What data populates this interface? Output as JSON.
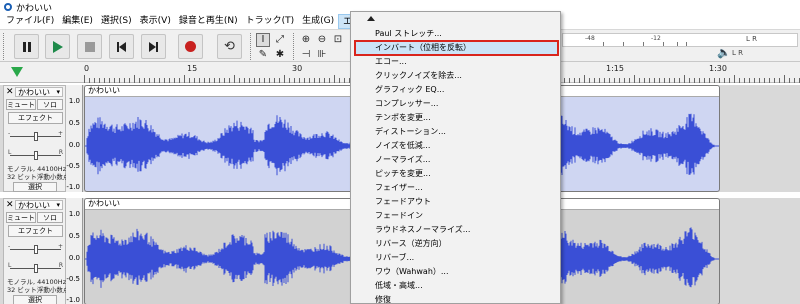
{
  "window": {
    "title": "かわいい"
  },
  "menu": [
    {
      "label": "ファイル(F)"
    },
    {
      "label": "編集(E)"
    },
    {
      "label": "選択(S)"
    },
    {
      "label": "表示(V)"
    },
    {
      "label": "録音と再生(N)"
    },
    {
      "label": "トラック(T)"
    },
    {
      "label": "生成(G)"
    },
    {
      "label": "エフェクト(C)",
      "active": true
    }
  ],
  "toolbar": {
    "meter_ticks": [
      "-48",
      "-12",
      "-48",
      "-12"
    ],
    "meter_labels": {
      "record": "L R",
      "play": "L R"
    }
  },
  "ruler": {
    "labels": [
      "0",
      "15",
      "30",
      "1:15",
      "1:30"
    ]
  },
  "tracks": [
    {
      "name": "かわいい",
      "mute_label": "ミュート",
      "solo_label": "ソロ",
      "effects_label": "エフェクト",
      "gain_minus": "-",
      "gain_plus": "+",
      "pan_l": "L",
      "pan_r": "R",
      "info_line1": "モノラル, 44100Hz",
      "info_line2": "32 ビット浮動小数点",
      "select_label": "選択",
      "scale": [
        "1.0",
        "0.5",
        "0.0",
        "-0.5",
        "-1.0"
      ],
      "clip_name": "かわいい"
    },
    {
      "name": "かわいい",
      "mute_label": "ミュート",
      "solo_label": "ソロ",
      "effects_label": "エフェクト",
      "gain_minus": "-",
      "gain_plus": "+",
      "pan_l": "L",
      "pan_r": "R",
      "info_line1": "モノラル, 44100Hz",
      "info_line2": "32 ビット浮動小数点",
      "select_label": "選択",
      "scale": [
        "1.0",
        "0.5",
        "0.0",
        "-0.5",
        "-1.0"
      ],
      "clip_name": "かわいい"
    }
  ],
  "effects_menu": {
    "items": [
      "Paul ストレッチ...",
      "インバート（位相を反転）",
      "エコー...",
      "クリックノイズを除去...",
      "グラフィック EQ...",
      "コンプレッサー...",
      "テンポを変更...",
      "ディストーション...",
      "ノイズを低減...",
      "ノーマライズ...",
      "ピッチを変更...",
      "フェイザー...",
      "フェードアウト",
      "フェードイン",
      "ラウドネスノーマライズ...",
      "リバース（逆方向）",
      "リバーブ...",
      "ワウ（Wahwah）...",
      "低域・高域...",
      "修復"
    ],
    "highlighted_index": 1
  },
  "colors": {
    "waveform": "#3a4fd6",
    "clip_bg_selected": "#cfd6f2",
    "highlight_border": "#d9251d",
    "highlight_bg": "#cce4f7"
  }
}
